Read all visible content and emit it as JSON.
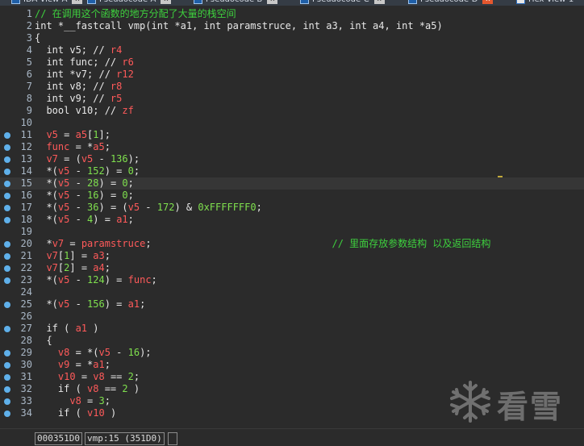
{
  "tabs": [
    {
      "label": "IDA View-A",
      "close": "x"
    },
    {
      "label": "Pseudocode-A",
      "close": "x"
    },
    {
      "label": "Pseudocode-B",
      "close": "x"
    },
    {
      "label": "Pseudocode-C",
      "close": "x"
    },
    {
      "label": "Pseudocode-D",
      "close": "x"
    },
    {
      "label": "Hex View-1",
      "close": ""
    }
  ],
  "code_lines": [
    {
      "n": "1",
      "bp": false,
      "tokens": [
        {
          "t": "// 在调用这个函数的地方分配了大量的栈空间",
          "c": "c"
        }
      ]
    },
    {
      "n": "2",
      "bp": false,
      "tokens": [
        {
          "t": "int *__fastcall vmp(int *a1, int paramstruce, int a3, int a4, int *a5)",
          "c": "k"
        }
      ]
    },
    {
      "n": "3",
      "bp": false,
      "tokens": [
        {
          "t": "{",
          "c": "k"
        }
      ]
    },
    {
      "n": "4",
      "bp": false,
      "tokens": [
        {
          "t": "  int v5; // ",
          "c": "k"
        },
        {
          "t": "r4",
          "c": "v"
        }
      ]
    },
    {
      "n": "5",
      "bp": false,
      "tokens": [
        {
          "t": "  int func; // ",
          "c": "k"
        },
        {
          "t": "r6",
          "c": "v"
        }
      ]
    },
    {
      "n": "6",
      "bp": false,
      "tokens": [
        {
          "t": "  int *v7; // ",
          "c": "k"
        },
        {
          "t": "r12",
          "c": "v"
        }
      ]
    },
    {
      "n": "7",
      "bp": false,
      "tokens": [
        {
          "t": "  int v8; // ",
          "c": "k"
        },
        {
          "t": "r8",
          "c": "v"
        }
      ]
    },
    {
      "n": "8",
      "bp": false,
      "tokens": [
        {
          "t": "  int v9; // ",
          "c": "k"
        },
        {
          "t": "r5",
          "c": "v"
        }
      ]
    },
    {
      "n": "9",
      "bp": false,
      "tokens": [
        {
          "t": "  bool v10; // ",
          "c": "k"
        },
        {
          "t": "zf",
          "c": "v"
        }
      ]
    },
    {
      "n": "10",
      "bp": false,
      "tokens": []
    },
    {
      "n": "11",
      "bp": true,
      "tokens": [
        {
          "t": "  ",
          "c": "k"
        },
        {
          "t": "v5",
          "c": "v"
        },
        {
          "t": " = ",
          "c": "k"
        },
        {
          "t": "a5",
          "c": "v"
        },
        {
          "t": "[",
          "c": "k"
        },
        {
          "t": "1",
          "c": "n"
        },
        {
          "t": "];",
          "c": "k"
        }
      ]
    },
    {
      "n": "12",
      "bp": true,
      "tokens": [
        {
          "t": "  ",
          "c": "k"
        },
        {
          "t": "func",
          "c": "v"
        },
        {
          "t": " = *",
          "c": "k"
        },
        {
          "t": "a5",
          "c": "v"
        },
        {
          "t": ";",
          "c": "k"
        }
      ]
    },
    {
      "n": "13",
      "bp": true,
      "tokens": [
        {
          "t": "  ",
          "c": "k"
        },
        {
          "t": "v7",
          "c": "v"
        },
        {
          "t": " = (",
          "c": "k"
        },
        {
          "t": "v5",
          "c": "v"
        },
        {
          "t": " - ",
          "c": "k"
        },
        {
          "t": "136",
          "c": "n"
        },
        {
          "t": ");",
          "c": "k"
        }
      ]
    },
    {
      "n": "14",
      "bp": true,
      "tokens": [
        {
          "t": "  *(",
          "c": "k"
        },
        {
          "t": "v5",
          "c": "v"
        },
        {
          "t": " - ",
          "c": "k"
        },
        {
          "t": "152",
          "c": "n"
        },
        {
          "t": ") = ",
          "c": "k"
        },
        {
          "t": "0",
          "c": "n"
        },
        {
          "t": ";",
          "c": "k"
        }
      ]
    },
    {
      "n": "15",
      "bp": true,
      "cur": true,
      "tokens": [
        {
          "t": "  *(",
          "c": "k"
        },
        {
          "t": "v5",
          "c": "v"
        },
        {
          "t": " - ",
          "c": "k"
        },
        {
          "t": "28",
          "c": "n"
        },
        {
          "t": ") = ",
          "c": "k"
        },
        {
          "t": "0",
          "c": "n"
        },
        {
          "t": ";",
          "c": "k"
        }
      ]
    },
    {
      "n": "16",
      "bp": true,
      "tokens": [
        {
          "t": "  *(",
          "c": "k"
        },
        {
          "t": "v5",
          "c": "v"
        },
        {
          "t": " - ",
          "c": "k"
        },
        {
          "t": "16",
          "c": "n"
        },
        {
          "t": ") = ",
          "c": "k"
        },
        {
          "t": "0",
          "c": "n"
        },
        {
          "t": ";",
          "c": "k"
        }
      ]
    },
    {
      "n": "17",
      "bp": true,
      "tokens": [
        {
          "t": "  *(",
          "c": "k"
        },
        {
          "t": "v5",
          "c": "v"
        },
        {
          "t": " - ",
          "c": "k"
        },
        {
          "t": "36",
          "c": "n"
        },
        {
          "t": ") = (",
          "c": "k"
        },
        {
          "t": "v5",
          "c": "v"
        },
        {
          "t": " - ",
          "c": "k"
        },
        {
          "t": "172",
          "c": "n"
        },
        {
          "t": ") & ",
          "c": "k"
        },
        {
          "t": "0xFFFFFFF0",
          "c": "n"
        },
        {
          "t": ";",
          "c": "k"
        }
      ]
    },
    {
      "n": "18",
      "bp": true,
      "tokens": [
        {
          "t": "  *(",
          "c": "k"
        },
        {
          "t": "v5",
          "c": "v"
        },
        {
          "t": " - ",
          "c": "k"
        },
        {
          "t": "4",
          "c": "n"
        },
        {
          "t": ") = ",
          "c": "k"
        },
        {
          "t": "a1",
          "c": "v"
        },
        {
          "t": ";",
          "c": "k"
        }
      ]
    },
    {
      "n": "19",
      "bp": false,
      "tokens": []
    },
    {
      "n": "20",
      "bp": true,
      "tokens": [
        {
          "t": "  *",
          "c": "k"
        },
        {
          "t": "v7",
          "c": "v"
        },
        {
          "t": " = ",
          "c": "k"
        },
        {
          "t": "paramstruce",
          "c": "v"
        },
        {
          "t": ";                               ",
          "c": "k"
        },
        {
          "t": "// 里面存放参数结构 以及返回结构",
          "c": "c"
        }
      ]
    },
    {
      "n": "21",
      "bp": true,
      "tokens": [
        {
          "t": "  ",
          "c": "k"
        },
        {
          "t": "v7",
          "c": "v"
        },
        {
          "t": "[",
          "c": "k"
        },
        {
          "t": "1",
          "c": "n"
        },
        {
          "t": "] = ",
          "c": "k"
        },
        {
          "t": "a3",
          "c": "v"
        },
        {
          "t": ";",
          "c": "k"
        }
      ]
    },
    {
      "n": "22",
      "bp": true,
      "tokens": [
        {
          "t": "  ",
          "c": "k"
        },
        {
          "t": "v7",
          "c": "v"
        },
        {
          "t": "[",
          "c": "k"
        },
        {
          "t": "2",
          "c": "n"
        },
        {
          "t": "] = ",
          "c": "k"
        },
        {
          "t": "a4",
          "c": "v"
        },
        {
          "t": ";",
          "c": "k"
        }
      ]
    },
    {
      "n": "23",
      "bp": true,
      "tokens": [
        {
          "t": "  *(",
          "c": "k"
        },
        {
          "t": "v5",
          "c": "v"
        },
        {
          "t": " - ",
          "c": "k"
        },
        {
          "t": "124",
          "c": "n"
        },
        {
          "t": ") = ",
          "c": "k"
        },
        {
          "t": "func",
          "c": "v"
        },
        {
          "t": ";",
          "c": "k"
        }
      ]
    },
    {
      "n": "24",
      "bp": false,
      "tokens": []
    },
    {
      "n": "25",
      "bp": true,
      "tokens": [
        {
          "t": "  *(",
          "c": "k"
        },
        {
          "t": "v5",
          "c": "v"
        },
        {
          "t": " - ",
          "c": "k"
        },
        {
          "t": "156",
          "c": "n"
        },
        {
          "t": ") = ",
          "c": "k"
        },
        {
          "t": "a1",
          "c": "v"
        },
        {
          "t": ";",
          "c": "k"
        }
      ]
    },
    {
      "n": "26",
      "bp": false,
      "tokens": []
    },
    {
      "n": "27",
      "bp": true,
      "tokens": [
        {
          "t": "  if ( ",
          "c": "k"
        },
        {
          "t": "a1",
          "c": "v"
        },
        {
          "t": " )",
          "c": "k"
        }
      ]
    },
    {
      "n": "28",
      "bp": false,
      "tokens": [
        {
          "t": "  {",
          "c": "k"
        }
      ]
    },
    {
      "n": "29",
      "bp": true,
      "tokens": [
        {
          "t": "    ",
          "c": "k"
        },
        {
          "t": "v8",
          "c": "v"
        },
        {
          "t": " = *(",
          "c": "k"
        },
        {
          "t": "v5",
          "c": "v"
        },
        {
          "t": " - ",
          "c": "k"
        },
        {
          "t": "16",
          "c": "n"
        },
        {
          "t": ");",
          "c": "k"
        }
      ]
    },
    {
      "n": "30",
      "bp": true,
      "tokens": [
        {
          "t": "    ",
          "c": "k"
        },
        {
          "t": "v9",
          "c": "v"
        },
        {
          "t": " = *",
          "c": "k"
        },
        {
          "t": "a1",
          "c": "v"
        },
        {
          "t": ";",
          "c": "k"
        }
      ]
    },
    {
      "n": "31",
      "bp": true,
      "tokens": [
        {
          "t": "    ",
          "c": "k"
        },
        {
          "t": "v10",
          "c": "v"
        },
        {
          "t": " = ",
          "c": "k"
        },
        {
          "t": "v8",
          "c": "v"
        },
        {
          "t": " == ",
          "c": "k"
        },
        {
          "t": "2",
          "c": "n"
        },
        {
          "t": ";",
          "c": "k"
        }
      ]
    },
    {
      "n": "32",
      "bp": true,
      "tokens": [
        {
          "t": "    if ( ",
          "c": "k"
        },
        {
          "t": "v8",
          "c": "v"
        },
        {
          "t": " == ",
          "c": "k"
        },
        {
          "t": "2",
          "c": "n"
        },
        {
          "t": " )",
          "c": "k"
        }
      ]
    },
    {
      "n": "33",
      "bp": true,
      "tokens": [
        {
          "t": "      ",
          "c": "k"
        },
        {
          "t": "v8",
          "c": "v"
        },
        {
          "t": " = ",
          "c": "k"
        },
        {
          "t": "3",
          "c": "n"
        },
        {
          "t": ";",
          "c": "k"
        }
      ]
    },
    {
      "n": "34",
      "bp": true,
      "tokens": [
        {
          "t": "    if ( ",
          "c": "k"
        },
        {
          "t": "v10",
          "c": "v"
        },
        {
          "t": " )",
          "c": "k"
        }
      ]
    }
  ],
  "watermark": {
    "text": "看雪",
    "icon": "snowflake-icon"
  },
  "status": {
    "address": "000351D0",
    "location": "vmp:15 (351D0)",
    "extra": ""
  },
  "colors": {
    "background": "#2b2b2b",
    "variable": "#ff5a5a",
    "number": "#7fe04e",
    "comment": "#3ed13e",
    "breakpoint": "#5fb0ea",
    "cursor": "#c2a93a"
  }
}
